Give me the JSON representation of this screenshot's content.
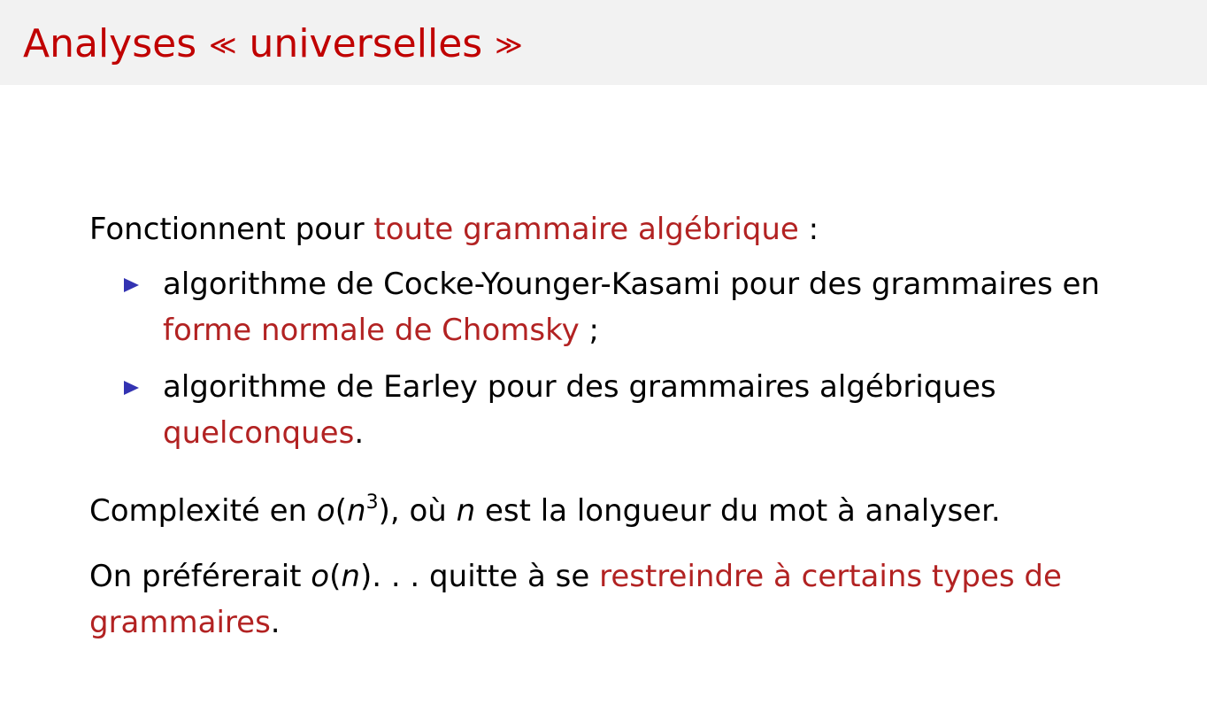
{
  "slide": {
    "title": {
      "word1": "Analyses",
      "open_quote": "≪",
      "word2": "universelles",
      "close_quote": "≫"
    },
    "intro": {
      "text": "Fonctionnent pour ",
      "highlight": "toute grammaire algébrique",
      "end": " :"
    },
    "bullets": [
      {
        "text": "algorithme de Cocke-Younger-Kasami pour des grammaires en ",
        "highlight": "forme normale de Chomsky",
        "end": " ;"
      },
      {
        "text": "algorithme de Earley pour des grammaires algébriques ",
        "highlight": "quelconques",
        "end": "."
      }
    ],
    "complexity": {
      "before": "Complexité en ",
      "o": "o",
      "paren_open": "(",
      "n": "n",
      "exp": "3",
      "paren_close": ")",
      "mid": ", où ",
      "var": "n",
      "after": " est la longueur du mot à analyser."
    },
    "preference": {
      "before": "On préférerait ",
      "o": "o",
      "paren_open": "(",
      "n": "n",
      "paren_close": ")",
      "ellipsis": ". . .",
      "mid": " quitte à se ",
      "highlight1": "restreindre à certains types de grammaires",
      "end": "."
    }
  }
}
